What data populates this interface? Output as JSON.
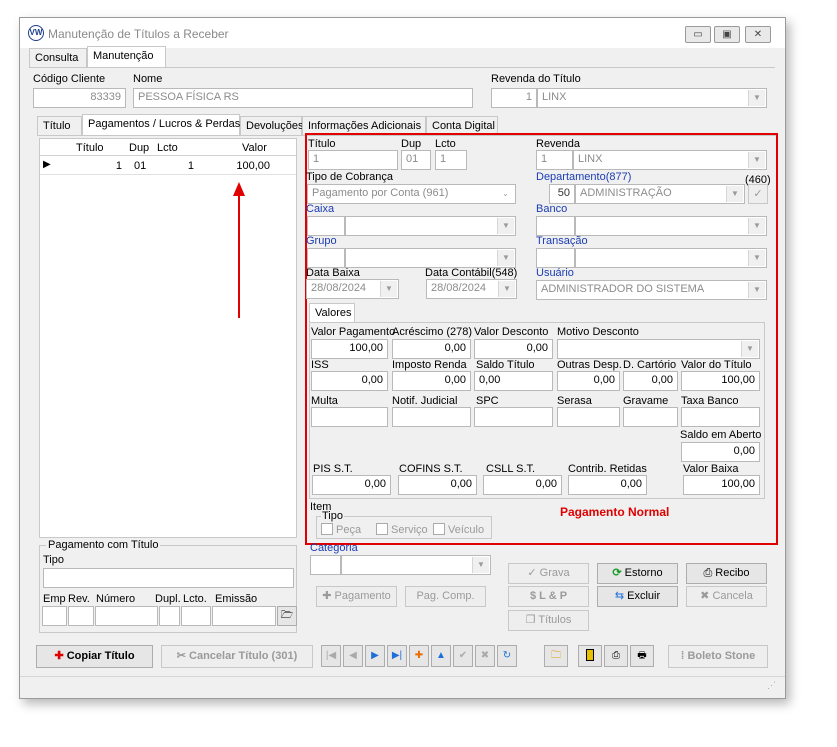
{
  "window": {
    "title": "Manutenção de Títulos a Receber",
    "logo_text": "VW",
    "minimize_glyph": "▭",
    "restore_glyph": "▣",
    "close_glyph": "✕"
  },
  "main_tabs": [
    "Consulta",
    "Manutenção"
  ],
  "header": {
    "codigo_cliente_label": "Código Cliente",
    "codigo_cliente_value": "83339",
    "nome_label": "Nome",
    "nome_value": "PESSOA FÍSICA  RS",
    "revenda_titulo_label": "Revenda do Título",
    "revenda_code": "1",
    "revenda_name": "LINX"
  },
  "sub_tabs": [
    "Título",
    "Pagamentos / Lucros & Perdas",
    "Devoluções",
    "Informações Adicionais",
    "Conta Digital"
  ],
  "grid": {
    "columns": [
      "Título",
      "Dup",
      "Lcto",
      "Valor"
    ],
    "rows": [
      {
        "titulo": "1",
        "dup": "01",
        "lcto": "1",
        "valor": "100,00"
      }
    ]
  },
  "pagamento_com_titulo": {
    "group_label": "Pagamento com Título",
    "tipo_label": "Tipo",
    "labels": [
      "Emp",
      "Rev.",
      "Número",
      "Dupl.",
      "Lcto.",
      "Emissão"
    ]
  },
  "detail": {
    "titulo_label": "Título",
    "titulo_value": "1",
    "dup_label": "Dup",
    "dup_value": "01",
    "lcto_label": "Lcto",
    "lcto_value": "1",
    "revenda_label": "Revenda",
    "revenda_code": "1",
    "revenda_name": "LINX",
    "tipo_cobranca_label": "Tipo de Cobrança",
    "tipo_cobranca_value": "Pagamento por Conta (961)",
    "departamento_label": "Departamento(877)",
    "departamento_code": "50",
    "departamento_name": "ADMINISTRAÇÃO",
    "dept_extra": "(460)",
    "caixa_label": "Caixa",
    "banco_label": "Banco",
    "grupo_label": "Grupo",
    "transacao_label": "Transação",
    "data_baixa_label": "Data Baixa",
    "data_baixa_value": "28/08/2024",
    "data_contabil_label": "Data Contábil(548)",
    "data_contabil_value": "28/08/2024",
    "usuario_label": "Usuário",
    "usuario_value": "ADMINISTRADOR DO SISTEMA"
  },
  "valores": {
    "tab_label": "Valores",
    "valor_pagamento_label": "Valor Pagamento",
    "valor_pagamento": "100,00",
    "acrescimo_label": "Acréscimo (278)",
    "acrescimo": "0,00",
    "valor_desconto_label": "Valor Desconto",
    "valor_desconto": "0,00",
    "motivo_desconto_label": "Motivo Desconto",
    "iss_label": "ISS",
    "iss": "0,00",
    "imposto_renda_label": "Imposto Renda",
    "imposto_renda": "0,00",
    "saldo_titulo_label": "Saldo Título",
    "saldo_titulo": "0,00",
    "outras_desp_label": "Outras Desp.",
    "outras_desp": "0,00",
    "d_cartorio_label": "D. Cartório",
    "d_cartorio": "0,00",
    "valor_titulo_label": "Valor do Título",
    "valor_titulo": "100,00",
    "multa_label": "Multa",
    "notif_judicial_label": "Notif. Judicial",
    "spc_label": "SPC",
    "serasa_label": "Serasa",
    "gravame_label": "Gravame",
    "taxa_banco_label": "Taxa Banco",
    "saldo_aberto_label": "Saldo em Aberto",
    "saldo_aberto": "0,00",
    "pis_label": "PIS S.T.",
    "pis": "0,00",
    "cofins_label": "COFINS S.T.",
    "cofins": "0,00",
    "csll_label": "CSLL S.T.",
    "csll": "0,00",
    "contrib_label": "Contrib. Retidas",
    "contrib": "0,00",
    "valor_baixa_label": "Valor Baixa",
    "valor_baixa": "100,00"
  },
  "item": {
    "item_label": "Item",
    "tipo_label": "Tipo",
    "options": [
      "Peça",
      "Serviço",
      "Veículo"
    ],
    "categoria_label": "Categoria"
  },
  "annotation": "Pagamento Normal",
  "buttons": {
    "pagamento": "Pagamento",
    "pag_comp": "Pag. Comp.",
    "grava": "Grava",
    "estorno": "Estorno",
    "recibo": "Recibo",
    "lp": "L & P",
    "excluir": "Excluir",
    "cancela": "Cancela",
    "titulos": "Títulos",
    "copiar_titulo": "Copiar Título",
    "cancelar_titulo": "Cancelar Título (301)",
    "boleto_stone": "Boleto Stone"
  },
  "nav_glyphs": [
    "|◀",
    "◀",
    "▶",
    "▶|",
    "✚",
    "▲",
    "✔",
    "✖",
    "↻"
  ],
  "colors": {
    "accent_red": "#e00000",
    "label_blue": "#1a3cb3",
    "nav_blue": "#1e6fd8"
  }
}
